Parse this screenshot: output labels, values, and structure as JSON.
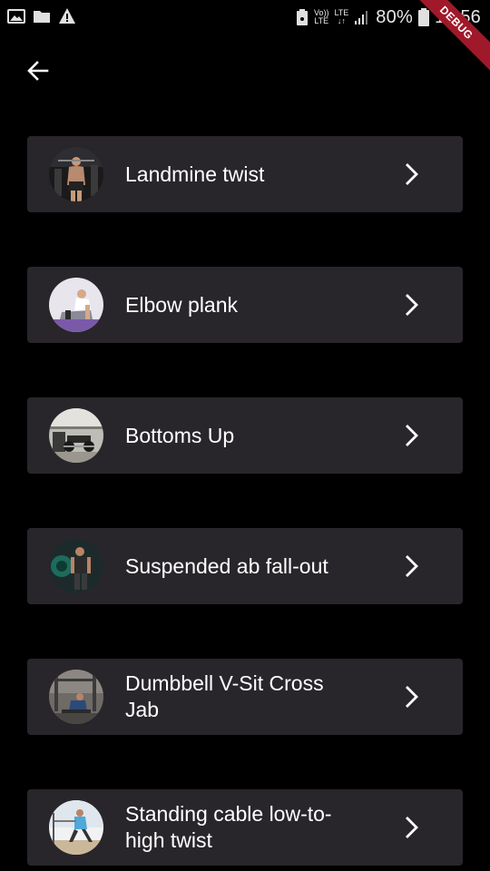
{
  "status_bar": {
    "battery": "80%",
    "time": "15:56",
    "network_top": "Vo))",
    "network_bottom": "LTE",
    "lte_top": "LTE",
    "lte_bottom": "↓↑",
    "icons": [
      "image-icon",
      "folder-icon",
      "warning-icon",
      "lock-icon",
      "signal-icon",
      "battery-icon"
    ]
  },
  "debug_banner": "DEBUG",
  "app_bar": {
    "back_icon": "arrow-left-icon"
  },
  "exercises": [
    {
      "label": "Landmine twist",
      "thumb": "photo-gym-dark"
    },
    {
      "label": "Elbow plank",
      "thumb": "photo-plank-light"
    },
    {
      "label": "Bottoms Up",
      "thumb": "photo-gym-bench"
    },
    {
      "label": "Suspended ab fall-out",
      "thumb": "photo-gym-green"
    },
    {
      "label": "Dumbbell V-Sit Cross Jab",
      "thumb": "photo-gym-floor"
    },
    {
      "label": "Standing cable low-to-high twist",
      "thumb": "photo-outdoor-lunge"
    }
  ],
  "colors": {
    "background": "#000000",
    "card": "#29262b",
    "text": "#ffffff",
    "debug_banner": "#a0192b"
  }
}
